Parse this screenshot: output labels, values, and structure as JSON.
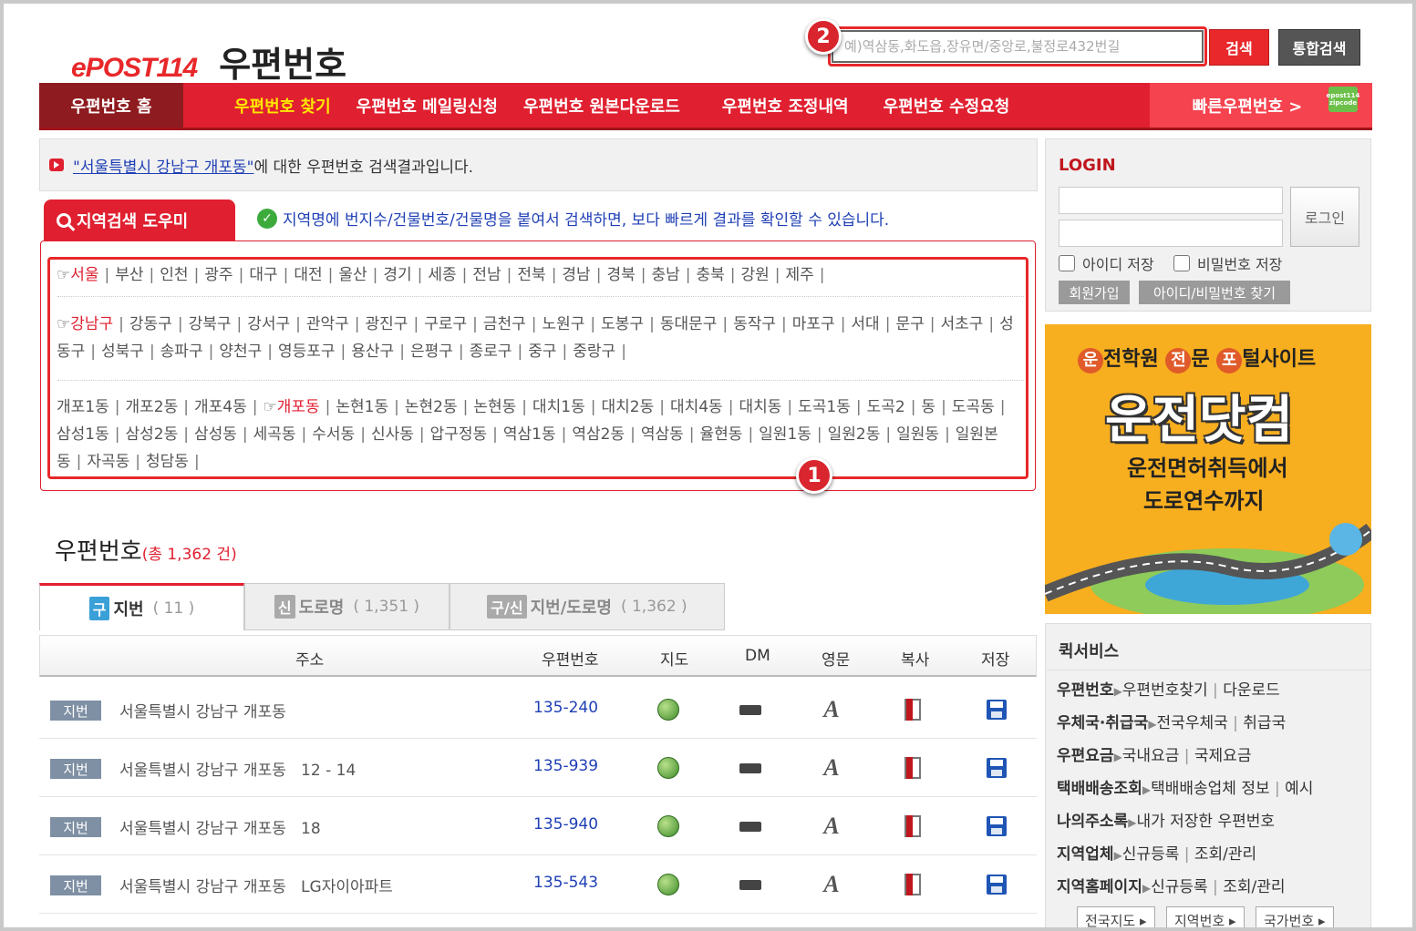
{
  "header": {
    "logo_mark": "ePOST114",
    "logo_title": "우편번호",
    "search_placeholder": "예)역삼동,화도읍,장유면/중앙로,불정로432번길",
    "search_button": "검색",
    "unified_search_button": "통합검색"
  },
  "nav": {
    "home": "우편번호 홈",
    "items": [
      "우편번호 찾기",
      "우편번호 메일링신청",
      "우편번호 원본다운로드",
      "우편번호 조정내역",
      "우편번호 수정요청"
    ],
    "fast": "빠른우편번호 >",
    "zip_badge": "epost114 zipcode"
  },
  "result": {
    "query": "\"서울특별시 강남구 개포동\"",
    "suffix": " 에 대한 우편번호 검색결과입니다."
  },
  "helper": {
    "tab_label": "지역검색 도우미",
    "tip": "지역명에 번지수/건물번호/건물명을 붙여서 검색하면, 보다 빠르게 결과를 확인할 수 있습니다."
  },
  "areas": {
    "cities": [
      "서울",
      "부산",
      "인천",
      "광주",
      "대구",
      "대전",
      "울산",
      "경기",
      "세종",
      "전남",
      "전북",
      "경남",
      "경북",
      "충남",
      "충북",
      "강원",
      "제주"
    ],
    "districts": [
      "강남구",
      "강동구",
      "강북구",
      "강서구",
      "관악구",
      "광진구",
      "구로구",
      "금천구",
      "노원구",
      "도봉구",
      "동대문구",
      "동작구",
      "마포구",
      "서대",
      "문구",
      "서초구",
      "성동구",
      "성북구",
      "송파구",
      "양천구",
      "영등포구",
      "용산구",
      "은평구",
      "종로구",
      "중구",
      "중랑구"
    ],
    "dongs": [
      "개포1동",
      "개포2동",
      "개포4동",
      "개포동",
      "논현1동",
      "논현2동",
      "논현동",
      "대치1동",
      "대치2동",
      "대치4동",
      "대치동",
      "도곡1동",
      "도곡2",
      "동",
      "도곡동",
      "삼성1동",
      "삼성2동",
      "삼성동",
      "세곡동",
      "수서동",
      "신사동",
      "압구정동",
      "역삼1동",
      "역삼2동",
      "역삼동",
      "율현동",
      "일원1동",
      "일원2동",
      "일원동",
      "일원본동",
      "자곡동",
      "청담동"
    ],
    "selected_marker": "☞"
  },
  "annotations": {
    "badge1": "1",
    "badge2": "2"
  },
  "zipcode": {
    "title": "우편번호",
    "total": "(총 1,362 건)"
  },
  "tabs": [
    {
      "icon": "구",
      "label": "지번",
      "count": "( 11 )"
    },
    {
      "icon": "신",
      "label": "도로명",
      "count": "( 1,351 )"
    },
    {
      "icon": "구/신",
      "label": "지번/도로명",
      "count": "( 1,362 )"
    }
  ],
  "table": {
    "headers": [
      "주소",
      "우편번호",
      "지도",
      "DM",
      "영문",
      "복사",
      "저장"
    ],
    "rows": [
      {
        "tag": "지번",
        "address": "서울특별시 강남구 개포동",
        "zip": "135-240"
      },
      {
        "tag": "지번",
        "address": "서울특별시 강남구 개포동   12 - 14",
        "zip": "135-939"
      },
      {
        "tag": "지번",
        "address": "서울특별시 강남구 개포동   18",
        "zip": "135-940"
      },
      {
        "tag": "지번",
        "address": "서울특별시 강남구 개포동   LG자이아파트",
        "zip": "135-543"
      }
    ]
  },
  "login": {
    "title": "LOGIN",
    "button": "로그인",
    "save_id": "아이디 저장",
    "save_pw": "비밀번호 저장",
    "join": "회원가입",
    "find": "아이디/비밀번호 찾기"
  },
  "ad": {
    "top_c1": "운",
    "top_t1": "전학원 ",
    "top_c2": "전",
    "top_t2": "문 ",
    "top_c3": "포",
    "top_t3": "털사이트",
    "big": "운전닷컴",
    "sub1": "운전면허취득에서",
    "sub2": "도로연수까지"
  },
  "quick": {
    "title": "퀵서비스",
    "rows": [
      {
        "main": "우편번호",
        "a": "우편번호찾기",
        "b": "다운로드"
      },
      {
        "main": "우체국·취급국",
        "a": "전국우체국",
        "b": "취급국"
      },
      {
        "main": "우편요금",
        "a": "국내요금",
        "b": "국제요금"
      },
      {
        "main": "택배배송조회",
        "a": "택배배송업체 정보",
        "b": "예시"
      },
      {
        "main": "나의주소록",
        "a": "내가 저장한 우편번호",
        "b": ""
      },
      {
        "main": "지역업체",
        "a": "신규등록",
        "b": "조회/관리"
      },
      {
        "main": "지역홈페이지",
        "a": "신규등록",
        "b": "조회/관리"
      }
    ],
    "bottom": [
      "전국지도 ▸",
      "지역번호 ▸",
      "국가번호 ▸"
    ]
  }
}
